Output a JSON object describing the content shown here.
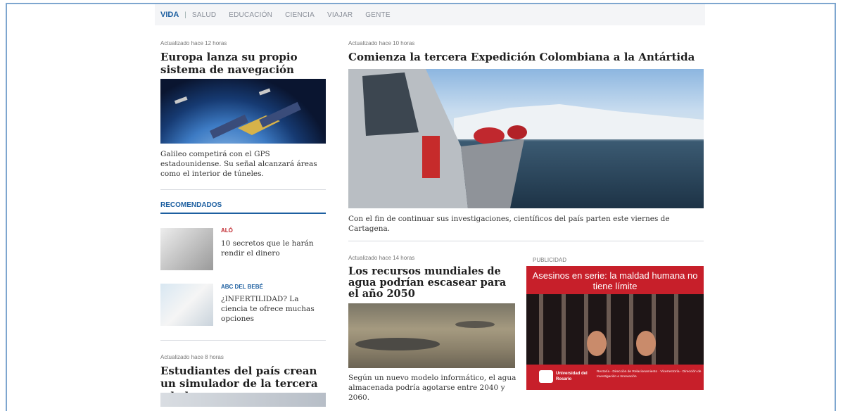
{
  "nav": {
    "active": "VIDA",
    "items": [
      "SALUD",
      "EDUCACIÓN",
      "CIENCIA",
      "VIAJAR",
      "GENTE"
    ]
  },
  "article1": {
    "updated": "Actualizado hace 12 horas",
    "title": "Europa lanza su propio sistema de navegación",
    "summary": "Galileo competirá con el GPS estadounidense. Su señal alcanzará áreas como el interior de túneles."
  },
  "article_main": {
    "updated": "Actualizado hace 10 horas",
    "title": "Comienza la tercera Expedición Colombiana a la Antártida",
    "summary": "Con el fin de continuar sus investigaciones, científicos del país parten este viernes de Cartagena."
  },
  "recommended": {
    "heading": "RECOMENDADOS",
    "items": [
      {
        "category": "ALÓ",
        "text": "10 secretos que le harán rendir el dinero"
      },
      {
        "category": "ABC DEL BEBÉ",
        "text": "¿INFERTILIDAD? La ciencia te ofrece muchas opciones"
      }
    ]
  },
  "article3": {
    "updated": "Actualizado hace 14 horas",
    "title": "Los recursos mundiales de agua podrían escasear para el año 2050",
    "summary": "Según un nuevo modelo informático, el agua almacenada podría agotarse entre 2040 y 2060."
  },
  "article4": {
    "updated": "Actualizado hace 8 horas",
    "title": "Estudiantes del país crean un simulador de la tercera edad"
  },
  "ad": {
    "label": "PUBLICIDAD",
    "headline": "Asesinos en serie: la maldad humana no tiene límite",
    "university": "Universidad del Rosario",
    "footer": "Rectoría - Dirección de Relacionamiento · Vicerrectoría - Dirección de Investigación e Innovación"
  },
  "colors": {
    "accent": "#1d5fa0",
    "category_red": "#c0272d",
    "ad_red": "#c71f2a",
    "frame": "#7ea6cf"
  }
}
